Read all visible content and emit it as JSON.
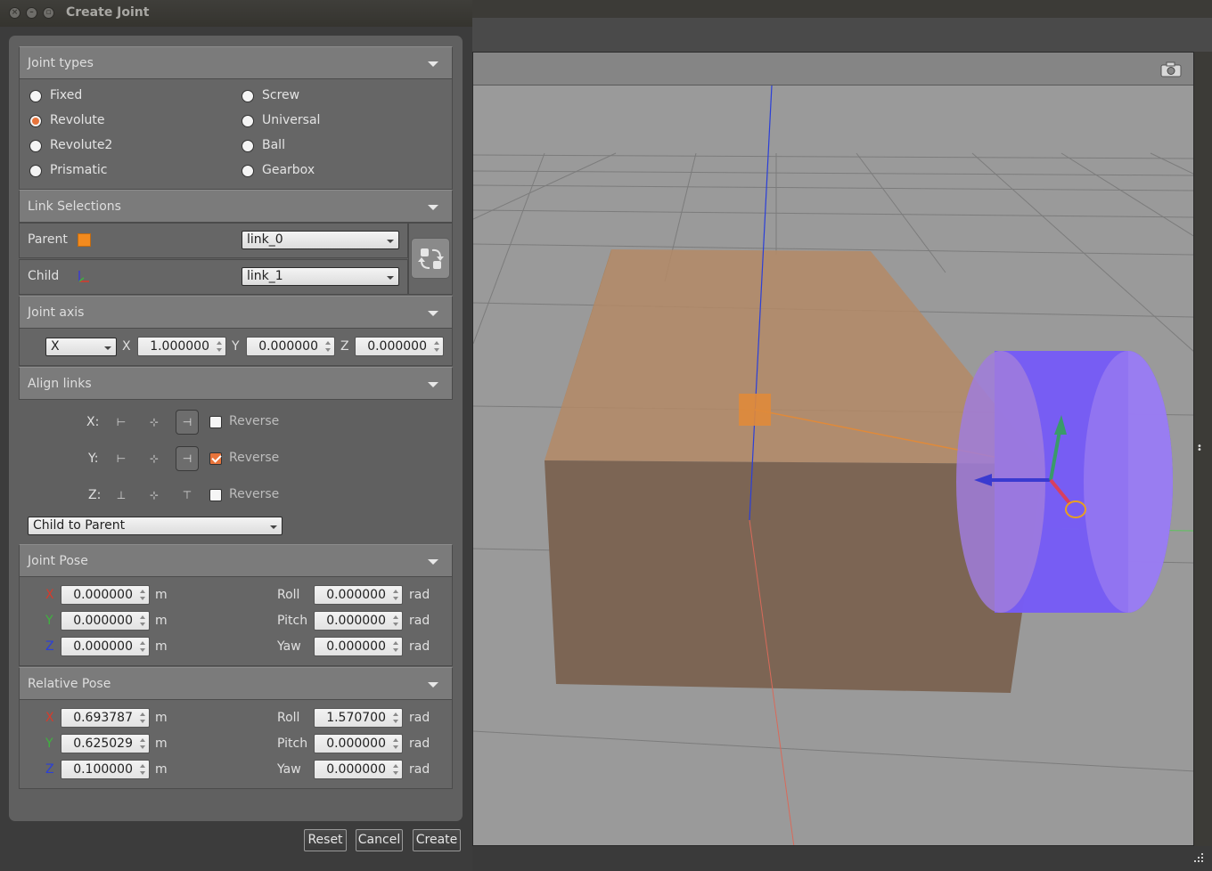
{
  "window": {
    "title": "Create Joint"
  },
  "joint_types": {
    "header": "Joint types",
    "options": [
      {
        "label": "Fixed",
        "selected": false
      },
      {
        "label": "Screw",
        "selected": false
      },
      {
        "label": "Revolute",
        "selected": true
      },
      {
        "label": "Universal",
        "selected": false
      },
      {
        "label": "Revolute2",
        "selected": false
      },
      {
        "label": "Ball",
        "selected": false
      },
      {
        "label": "Prismatic",
        "selected": false
      },
      {
        "label": "Gearbox",
        "selected": false
      }
    ]
  },
  "link_selections": {
    "header": "Link Selections",
    "parent_label": "Parent",
    "parent_value": "link_0",
    "child_label": "Child",
    "child_value": "link_1",
    "parent_color": "#f28a1e"
  },
  "joint_axis": {
    "header": "Joint axis",
    "axis_select": "X",
    "x_label": "X",
    "x_value": "1.000000",
    "y_label": "Y",
    "y_value": "0.000000",
    "z_label": "Z",
    "z_value": "0.000000"
  },
  "align_links": {
    "header": "Align links",
    "rows": [
      {
        "axis": "X:",
        "reverse_label": "Reverse",
        "reverse": false
      },
      {
        "axis": "Y:",
        "reverse_label": "Reverse",
        "reverse": true
      },
      {
        "axis": "Z:",
        "reverse_label": "Reverse",
        "reverse": false
      }
    ],
    "mode": "Child to Parent"
  },
  "joint_pose": {
    "header": "Joint Pose",
    "x_label": "X",
    "x": "0.000000",
    "y_label": "Y",
    "y": "0.000000",
    "z_label": "Z",
    "z": "0.000000",
    "roll_label": "Roll",
    "roll": "0.000000",
    "pitch_label": "Pitch",
    "pitch": "0.000000",
    "yaw_label": "Yaw",
    "yaw": "0.000000",
    "unit_m": "m",
    "unit_rad": "rad"
  },
  "relative_pose": {
    "header": "Relative Pose",
    "x_label": "X",
    "x": "0.693787",
    "y_label": "Y",
    "y": "0.625029",
    "z_label": "Z",
    "z": "0.100000",
    "roll_label": "Roll",
    "roll": "1.570700",
    "pitch_label": "Pitch",
    "pitch": "0.000000",
    "yaw_label": "Yaw",
    "yaw": "0.000000",
    "unit_m": "m",
    "unit_rad": "rad"
  },
  "buttons": {
    "reset": "Reset",
    "cancel": "Cancel",
    "create": "Create"
  },
  "colors": {
    "axis_x": "#d83a2a",
    "axis_y": "#3fb23f",
    "axis_z": "#2b3fd8",
    "accent": "#e8743b",
    "box": "#c39a72",
    "cylinder": "#7a5cff"
  },
  "icons": [
    "close-icon",
    "minimize-icon",
    "maximize-icon",
    "camera-icon",
    "swap-links-icon",
    "frame-axes-icon"
  ]
}
